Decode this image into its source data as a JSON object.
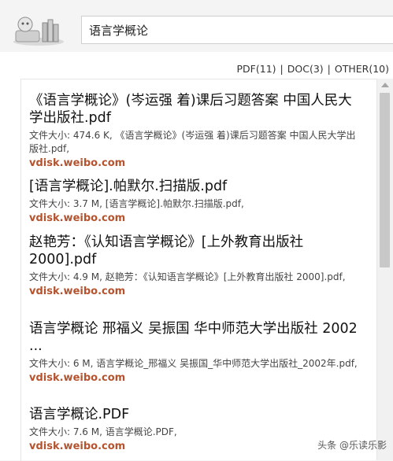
{
  "search": {
    "query": "语言学概论"
  },
  "filters": [
    {
      "label": "PDF(11)"
    },
    {
      "label": "DOC(3)"
    },
    {
      "label": "OTHER(10)"
    }
  ],
  "filter_separator": "|",
  "results": [
    {
      "title": "《语言学概论》(岑运强 着)课后习题答案 中国人民大学出版社.pdf",
      "desc": "文件大小: 474.6 K, 《语言学概论》(岑运强 着)课后习题答案 中国人民大学出版社.pdf,",
      "source": "vdisk.weibo.com"
    },
    {
      "title": "[语言学概论].帕默尔.扫描版.pdf",
      "desc": "文件大小: 3.7 M, [语言学概论].帕默尔.扫描版.pdf,",
      "source": "vdisk.weibo.com"
    },
    {
      "title": "赵艳芳：《认知语言学概论》[上外教育出版社 2000].pdf",
      "desc": "文件大小: 4.9 M, 赵艳芳：《认知语言学概论》[上外教育出版社 2000].pdf,",
      "source": "vdisk.weibo.com"
    },
    {
      "title": "语言学概论 邢福义 吴振国 华中师范大学出版社 2002 ...",
      "desc": "文件大小: 6 M, 语言学概论_邢福义 吴振国_华中师范大学出版社_2002年.pdf,",
      "source": "vdisk.weibo.com"
    },
    {
      "title": "语言学概论.PDF",
      "desc": "文件大小: 7.6 M, 语言学概论.PDF,",
      "source": "vdisk.weibo.com"
    }
  ],
  "watermark": "头条 @乐读乐影"
}
